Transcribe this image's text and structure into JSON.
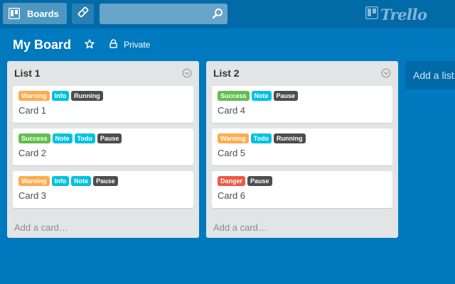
{
  "header": {
    "boards_label": "Boards",
    "search_placeholder": "",
    "logo_text": "Trello"
  },
  "board": {
    "title": "My Board",
    "visibility": "Private"
  },
  "label_colors": {
    "Warning": "#ffab4a",
    "Info": "#00c2e0",
    "Running": "#4d4d4d",
    "Success": "#61bd4f",
    "Note": "#00c2e0",
    "Todo": "#00c2e0",
    "Pause": "#4d4d4d",
    "Danger": "#eb5a46"
  },
  "lists": [
    {
      "title": "List 1",
      "add_card_label": "Add a card…",
      "cards": [
        {
          "title": "Card 1",
          "labels": [
            "Warning",
            "Info",
            "Running"
          ]
        },
        {
          "title": "Card 2",
          "labels": [
            "Success",
            "Note",
            "Todo",
            "Pause"
          ]
        },
        {
          "title": "Card 3",
          "labels": [
            "Warning",
            "Info",
            "Note",
            "Pause"
          ]
        }
      ]
    },
    {
      "title": "List 2",
      "add_card_label": "Add a card…",
      "cards": [
        {
          "title": "Card 4",
          "labels": [
            "Success",
            "Note",
            "Pause"
          ]
        },
        {
          "title": "Card 5",
          "labels": [
            "Warning",
            "Todo",
            "Running"
          ]
        },
        {
          "title": "Card 6",
          "labels": [
            "Danger",
            "Pause"
          ]
        }
      ]
    }
  ],
  "add_list_label": "Add a list…"
}
